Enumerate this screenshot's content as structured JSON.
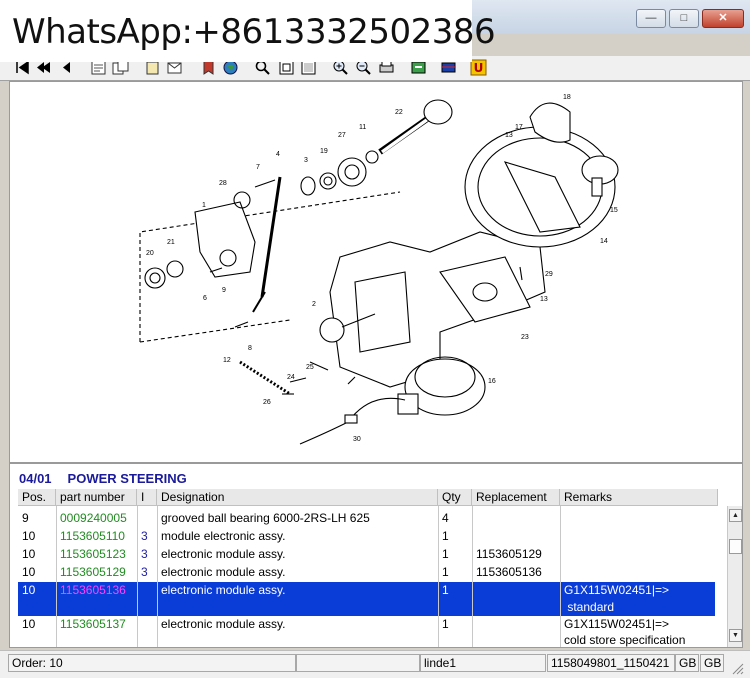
{
  "watermark": {
    "text": "WhatsApp:+8613332502386"
  },
  "window": {
    "minimize_icon": "minimize-icon",
    "maximize_icon": "maximize-icon",
    "close_icon": "close-icon"
  },
  "drawing": {
    "callouts": [
      "1",
      "2",
      "3",
      "4",
      "6",
      "7",
      "8",
      "9",
      "11",
      "12",
      "13",
      "13",
      "14",
      "15",
      "16",
      "17",
      "18",
      "19",
      "20",
      "21",
      "22",
      "23",
      "24",
      "25",
      "26",
      "27",
      "28",
      "29",
      "30"
    ]
  },
  "section": {
    "code": "04/01",
    "title": "POWER STEERING"
  },
  "columns": [
    "Pos.",
    "part number",
    "I",
    "Designation",
    "Qty",
    "Replacement",
    "Remarks"
  ],
  "rows": [
    {
      "pos": "9",
      "part": "0009240005",
      "i": "",
      "designation": "grooved ball bearing 6000-2RS-LH  625",
      "qty": "4",
      "replacement": "",
      "remarks": "",
      "remarks2": ""
    },
    {
      "pos": "10",
      "part": "1153605110",
      "i": "3",
      "designation": "module electronic assy.",
      "qty": "1",
      "replacement": "",
      "remarks": "",
      "remarks2": ""
    },
    {
      "pos": "10",
      "part": "1153605123",
      "i": "3",
      "designation": "electronic module assy.",
      "qty": "1",
      "replacement": "1153605129",
      "remarks": "",
      "remarks2": ""
    },
    {
      "pos": "10",
      "part": "1153605129",
      "i": "3",
      "designation": "electronic module assy.",
      "qty": "1",
      "replacement": "1153605136",
      "remarks": "",
      "remarks2": ""
    },
    {
      "pos": "10",
      "part": "1153605136",
      "i": "",
      "designation": "electronic module assy.",
      "qty": "1",
      "replacement": "",
      "remarks": "G1X115W02451|=>",
      "remarks2": " standard"
    },
    {
      "pos": "10",
      "part": "1153605137",
      "i": "",
      "designation": "electronic module assy.",
      "qty": "1",
      "replacement": "",
      "remarks": "G1X115W02451|=>",
      "remarks2": "cold store specification"
    }
  ],
  "status": {
    "order": "Order: 10",
    "user": "linde1",
    "doc": "1158049801_1150421",
    "lang1": "GB",
    "lang2": "GB"
  }
}
